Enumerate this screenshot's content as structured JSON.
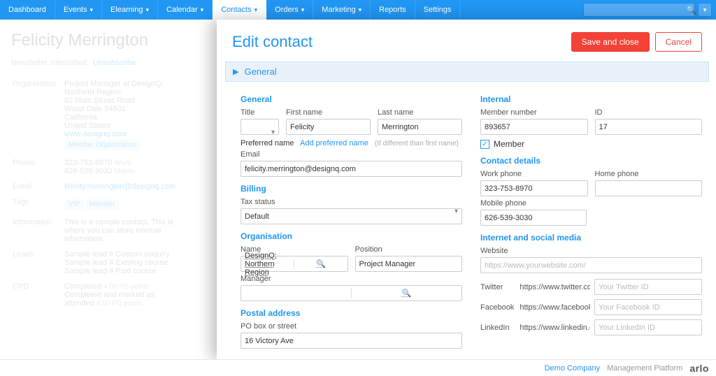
{
  "nav": {
    "items": [
      {
        "label": "Dashboard",
        "caret": false
      },
      {
        "label": "Events",
        "caret": true
      },
      {
        "label": "Elearning",
        "caret": true
      },
      {
        "label": "Calendar",
        "caret": true
      },
      {
        "label": "Contacts",
        "caret": true,
        "active": true
      },
      {
        "label": "Orders",
        "caret": true
      },
      {
        "label": "Marketing",
        "caret": true
      },
      {
        "label": "Reports",
        "caret": false
      },
      {
        "label": "Settings",
        "caret": false
      }
    ]
  },
  "bg": {
    "title": "Felicity Merrington",
    "subscribed": "Newsletter subscribed",
    "unsubscribe": "Unsubscribe",
    "org_label": "Organisation",
    "role_line": "Project Manager at DesignQ; Northern Region",
    "addr1": "82 Main Street Road",
    "addr2": "Wood Dale 94601",
    "addr3": "California",
    "addr4": "United States",
    "website": "www.designq.com",
    "member_org": "Member Organization",
    "phone_label": "Phone",
    "phone_work": "323-753-8970",
    "phone_work_tag": "Work",
    "phone_mobile": "626-539-3030",
    "phone_mobile_tag": "Mobile",
    "email_label": "Email",
    "email": "felicity.merrington@designq.com",
    "tags_label": "Tags",
    "tag_vip": "VIP",
    "tag_member": "Member",
    "info_label": "Information",
    "info_text": "This is a sample contact. This is where you can store internal information.",
    "leads_label": "Leads",
    "lead1": "Sample lead # Custom enquiry",
    "lead2": "Sample lead # Existing course",
    "lead3": "Sample lead # Paid course",
    "cpd_label": "CPD",
    "cpd1a": "Completed",
    "cpd1b": "4.00 PD points",
    "cpd2a": "Completed and marked as attended",
    "cpd2b": "4.00 PD points"
  },
  "panel": {
    "title": "Edit contact",
    "save": "Save and close",
    "cancel": "Cancel",
    "section": "General"
  },
  "form": {
    "general_heading": "General",
    "title_label": "Title",
    "title_value": "",
    "first_label": "First name",
    "first_value": "Felicity",
    "last_label": "Last name",
    "last_value": "Merrington",
    "pref_label": "Preferred name",
    "pref_link": "Add preferred name",
    "pref_hint": "(If different than first name)",
    "email_label": "Email",
    "email_value": "felicity.merrington@designq.com",
    "billing_heading": "Billing",
    "tax_label": "Tax status",
    "tax_value": "Default",
    "org_heading": "Organisation",
    "name_label": "Name",
    "name_value": "DesignQ; Northern Region",
    "position_label": "Position",
    "position_value": "Project Manager",
    "manager_label": "Manager",
    "postal_heading": "Postal address",
    "po_label": "PO box or street",
    "po_value": "16 Victory Ave",
    "internal_heading": "Internal",
    "member_no_label": "Member number",
    "member_no_value": "893657",
    "id_label": "ID",
    "id_value": "17",
    "member_chk": "Member",
    "contact_heading": "Contact details",
    "work_phone_label": "Work phone",
    "work_phone_value": "323-753-8970",
    "home_phone_label": "Home phone",
    "home_phone_value": "",
    "mobile_label": "Mobile phone",
    "mobile_value": "626-539-3030",
    "social_heading": "Internet and social media",
    "website_label": "Website",
    "website_placeholder": "https://www.yourwebsite.com/",
    "twitter_label": "Twitter",
    "twitter_prefix": "https://www.twitter.com/",
    "twitter_placeholder": "Your Twitter ID",
    "facebook_label": "Facebook",
    "facebook_prefix": "https://www.facebook.com/",
    "facebook_placeholder": "Your Facebook ID",
    "linkedin_label": "LinkedIn",
    "linkedin_prefix": "https://www.linkedin.com/",
    "linkedin_placeholder": "Your LinkedIn ID"
  },
  "footer": {
    "demo": "Demo Company",
    "platform": "Management Platform",
    "brand": "arlo"
  }
}
